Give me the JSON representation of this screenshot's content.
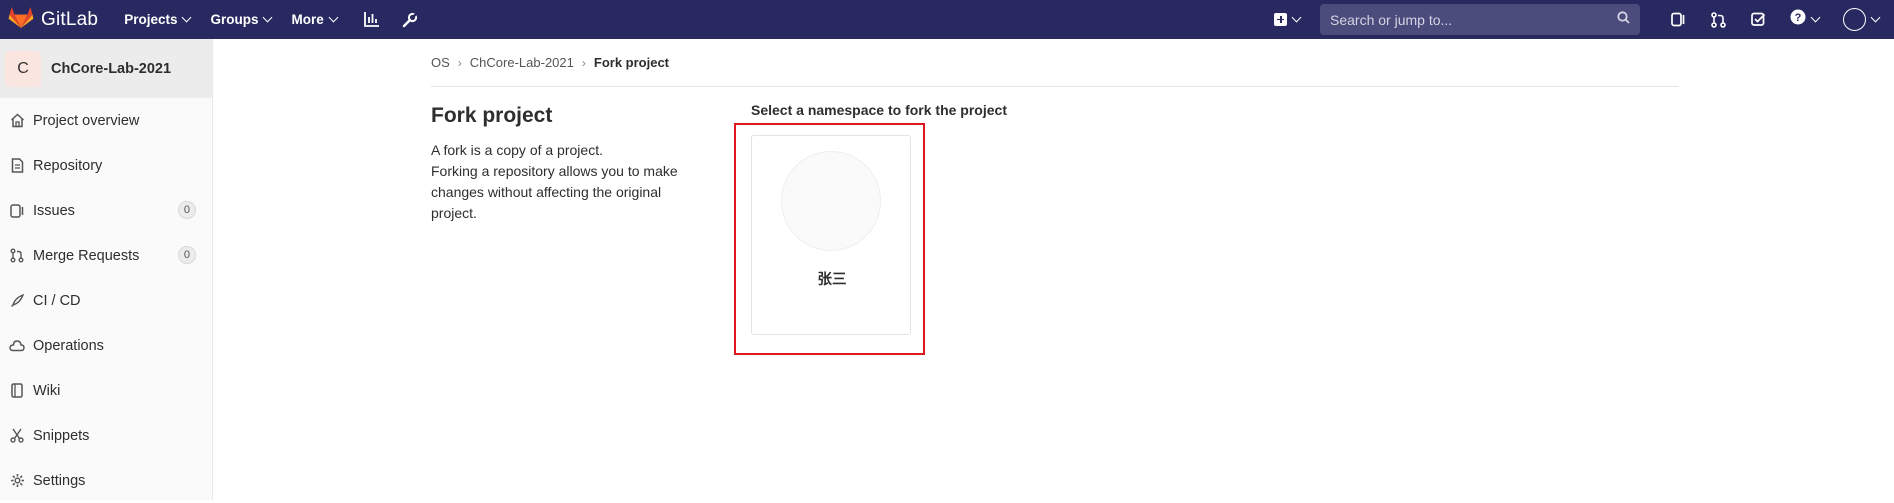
{
  "navbar": {
    "brand": "GitLab",
    "menu": [
      "Projects",
      "Groups",
      "More"
    ],
    "search_placeholder": "Search or jump to..."
  },
  "sidebar": {
    "project_initial": "C",
    "project_name": "ChCore-Lab-2021",
    "items": [
      {
        "label": "Project overview",
        "icon": "home-icon"
      },
      {
        "label": "Repository",
        "icon": "doc-icon"
      },
      {
        "label": "Issues",
        "icon": "issues-icon",
        "count": "0"
      },
      {
        "label": "Merge Requests",
        "icon": "merge-request-icon",
        "count": "0"
      },
      {
        "label": "CI / CD",
        "icon": "rocket-icon"
      },
      {
        "label": "Operations",
        "icon": "cloud-icon"
      },
      {
        "label": "Wiki",
        "icon": "book-icon"
      },
      {
        "label": "Snippets",
        "icon": "scissors-icon"
      },
      {
        "label": "Settings",
        "icon": "gear-icon"
      }
    ]
  },
  "breadcrumb": [
    "OS",
    "ChCore-Lab-2021",
    "Fork project"
  ],
  "page": {
    "title": "Fork project",
    "desc_line1": "A fork is a copy of a project.",
    "desc_line2": "Forking a repository allows you to make changes without affecting the original project.",
    "namespace_label": "Select a namespace to fork the project",
    "namespace_name": "张三"
  },
  "colors": {
    "navbar": "#292961",
    "highlight": "#e0171e"
  }
}
